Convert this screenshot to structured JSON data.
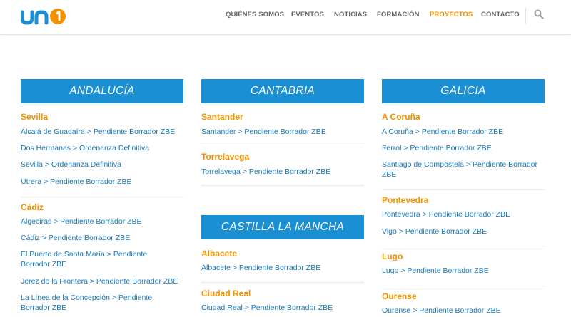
{
  "header": {
    "logo_text": "uno",
    "nav": [
      {
        "label": "QUIÉNES SOMOS"
      },
      {
        "label": "EVENTOS"
      },
      {
        "label": "NOTICIAS"
      },
      {
        "label": "FORMACIÓN"
      },
      {
        "label": "PROYECTOS",
        "active": true
      },
      {
        "label": "CONTACTO"
      }
    ],
    "search_icon": "search-icon"
  },
  "colors": {
    "accent": "#f39200",
    "region_header": "#1a8fd4",
    "link": "#1778b8",
    "nav": "#666666"
  },
  "columns": [
    {
      "regions": [
        {
          "name": "ANDALUCÍA",
          "cities": [
            {
              "title": "Sevilla",
              "links": [
                "Alcalá de Guadaíra > Pendiente Borrador ZBE",
                "Dos Hermanas > Ordenanza Definitiva",
                "Sevilla > Ordenanza Definitiva",
                "Utrera > Pendiente Borrador ZBE"
              ]
            },
            {
              "title": "Cádiz",
              "links": [
                "Algeciras > Pendiente Borrador ZBE",
                "Cádiz > Pendiente Borrador ZBE",
                "El Puerto de Santa María > Pendiente Borrador ZBE",
                "Jerez de la Frontera > Pendiente Borrador ZBE",
                "La Línea de la Concepción > Pendiente Borrador ZBE"
              ]
            }
          ]
        }
      ]
    },
    {
      "regions": [
        {
          "name": "CANTABRIA",
          "cities": [
            {
              "title": "Santander",
              "links": [
                "Santander > Pendiente Borrador ZBE"
              ]
            },
            {
              "title": "Torrelavega",
              "links": [
                "Torrelavega > Pendiente Borrador ZBE"
              ]
            }
          ]
        },
        {
          "name": "CASTILLA LA MANCHA",
          "cities": [
            {
              "title": "Albacete",
              "links": [
                "Albacete > Pendiente Borrador ZBE"
              ]
            },
            {
              "title": "Ciudad Real",
              "links": [
                "Ciudad Real > Pendiente Borrador ZBE"
              ]
            }
          ]
        }
      ]
    },
    {
      "regions": [
        {
          "name": "GALICIA",
          "cities": [
            {
              "title": "A Coruña",
              "links": [
                "A Coruña > Pendiente Borrador ZBE",
                "Ferrol > Pendiente Borrador ZBE",
                "Santiago de Compostela > Pendiente Borrador ZBE"
              ]
            },
            {
              "title": "Pontevedra",
              "links": [
                "Pontevedra > Pendiente Borrador ZBE",
                "Vigo > Pendiente Borrador ZBE"
              ]
            },
            {
              "title": "Lugo",
              "links": [
                "Lugo > Pendiente Borrador ZBE"
              ]
            },
            {
              "title": "Ourense",
              "links": [
                "Ourense > Pendiente Borrador ZBE"
              ]
            }
          ]
        }
      ]
    }
  ]
}
